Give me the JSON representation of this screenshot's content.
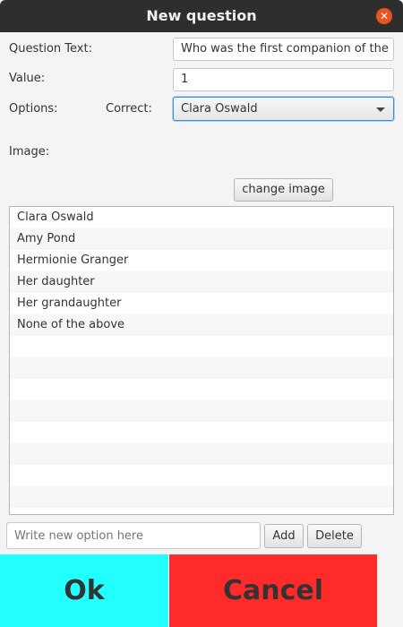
{
  "window": {
    "title": "New question"
  },
  "form": {
    "question_text_label": "Question Text:",
    "question_text_value": "Who was the first companion of the",
    "value_label": "Value:",
    "value_value": "1",
    "options_label": "Options:",
    "correct_label": "Correct:",
    "correct_selected": "Clara Oswald",
    "image_label": "Image:",
    "change_image_label": "change image"
  },
  "options_list": {
    "items": [
      "Clara Oswald",
      "Amy Pond",
      "Hermionie Granger",
      "Her daughter",
      "Her grandaughter",
      "None of the above"
    ],
    "empty_rows": 8
  },
  "new_option": {
    "placeholder": "Write new option here",
    "add_label": "Add",
    "delete_label": "Delete"
  },
  "footer": {
    "ok_label": "Ok",
    "cancel_label": "Cancel",
    "ok_color": "#22ffff",
    "cancel_color": "#ff2a2a"
  },
  "icons": {
    "close": "close-icon",
    "dropdown": "chevron-down-icon"
  }
}
